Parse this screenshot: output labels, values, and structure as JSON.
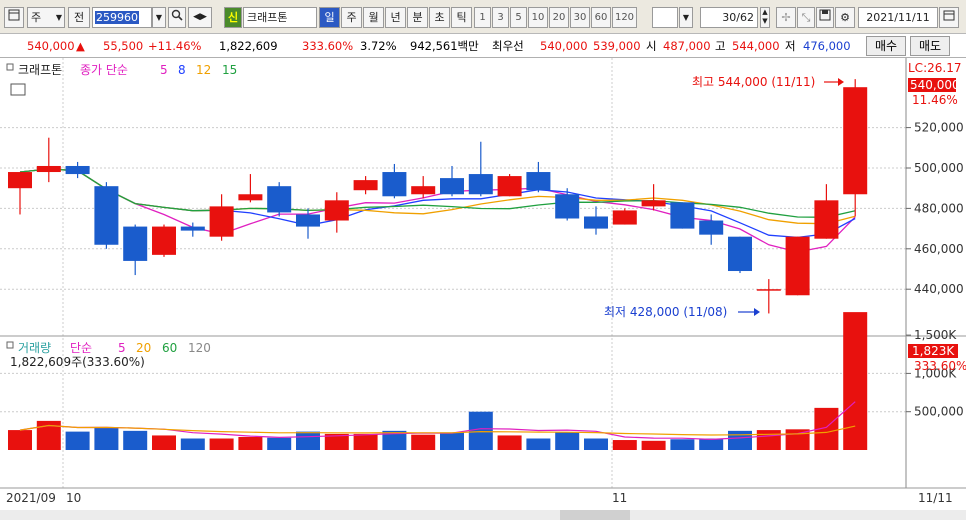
{
  "toolbar": {
    "mode": "주",
    "prev": "전",
    "code": "259960",
    "name": "크래프톤",
    "market_badge": "신",
    "period_tabs": [
      "일",
      "주",
      "월",
      "년",
      "분",
      "초",
      "틱"
    ],
    "period_active": "일",
    "intervals": [
      "1",
      "3",
      "5",
      "10",
      "20",
      "30",
      "60",
      "120"
    ],
    "page_count": "30/62",
    "date": "2021/11/11"
  },
  "quote": {
    "price": "540,000",
    "arrow": "▲",
    "change": "55,500",
    "change_pct": "+11.46%",
    "volume": "1,822,609",
    "vol_ratio": "333.60%",
    "turnover": "3.72%",
    "amount": "942,561백만",
    "status": "최우선",
    "bid": "540,000",
    "ask": "539,000",
    "open_label": "시",
    "open": "487,000",
    "high_label": "고",
    "high": "544,000",
    "low_label": "저",
    "low": "476,000",
    "buy_label": "매수",
    "sell_label": "매도"
  },
  "price_panel": {
    "legend_name": "크래프톤",
    "legend_ma": "종가 단순",
    "ma_periods": [
      "5",
      "8",
      "12",
      "15"
    ],
    "ma_colors": [
      "#e020c0",
      "#2040ff",
      "#f0a000",
      "#20a040"
    ],
    "y_ticks": [
      "520,000",
      "500,000",
      "480,000",
      "460,000",
      "440,000"
    ],
    "lc_label": "LC:26.17",
    "last_label": "540,000",
    "last_pct": "11.46%",
    "high_note": "최고 544,000 (11/11)",
    "low_note": "최저 428,000 (11/08)"
  },
  "volume_panel": {
    "legend_name": "거래량",
    "legend_ma": "단순",
    "ma_periods": [
      "5",
      "20",
      "60",
      "120"
    ],
    "ma_colors": [
      "#e020c0",
      "#f0a000",
      "#20a040",
      "#888888"
    ],
    "value_text": "1,822,609주(333.60%)",
    "y_ticks": [
      "1,500K",
      "1,000K",
      "500,000"
    ],
    "last_label": "1,823K",
    "last_pct": "333.60%"
  },
  "x_axis": {
    "labels": [
      "2021/09",
      "10",
      "11",
      "11/11"
    ]
  },
  "colors": {
    "up": "#e8110e",
    "down": "#1a5ccc"
  },
  "chart_data": {
    "type": "candlestick",
    "candles": [
      {
        "o": 490000,
        "h": 497000,
        "l": 477000,
        "c": 498000
      },
      {
        "o": 498000,
        "h": 515000,
        "l": 493000,
        "c": 501000
      },
      {
        "o": 501000,
        "h": 503000,
        "l": 495000,
        "c": 497000
      },
      {
        "o": 491000,
        "h": 493000,
        "l": 460000,
        "c": 462000
      },
      {
        "o": 471000,
        "h": 472000,
        "l": 447000,
        "c": 454000
      },
      {
        "o": 457000,
        "h": 472000,
        "l": 456000,
        "c": 471000
      },
      {
        "o": 471000,
        "h": 473000,
        "l": 466000,
        "c": 469000
      },
      {
        "o": 466000,
        "h": 487000,
        "l": 464000,
        "c": 481000
      },
      {
        "o": 484000,
        "h": 497000,
        "l": 483000,
        "c": 487000
      },
      {
        "o": 491000,
        "h": 493000,
        "l": 476000,
        "c": 478000
      },
      {
        "o": 477000,
        "h": 480000,
        "l": 465000,
        "c": 471000
      },
      {
        "o": 474000,
        "h": 488000,
        "l": 468000,
        "c": 484000
      },
      {
        "o": 489000,
        "h": 496000,
        "l": 487000,
        "c": 494000
      },
      {
        "o": 498000,
        "h": 502000,
        "l": 485000,
        "c": 486000
      },
      {
        "o": 487000,
        "h": 496000,
        "l": 485000,
        "c": 491000
      },
      {
        "o": 495000,
        "h": 501000,
        "l": 486000,
        "c": 487000
      },
      {
        "o": 497000,
        "h": 513000,
        "l": 486000,
        "c": 487000
      },
      {
        "o": 486000,
        "h": 497000,
        "l": 486000,
        "c": 496000
      },
      {
        "o": 498000,
        "h": 503000,
        "l": 488000,
        "c": 489000
      },
      {
        "o": 487000,
        "h": 490000,
        "l": 474000,
        "c": 475000
      },
      {
        "o": 476000,
        "h": 481000,
        "l": 467000,
        "c": 470000
      },
      {
        "o": 472000,
        "h": 480000,
        "l": 472000,
        "c": 479000
      },
      {
        "o": 481000,
        "h": 492000,
        "l": 479000,
        "c": 484000
      },
      {
        "o": 483000,
        "h": 483000,
        "l": 470000,
        "c": 470000
      },
      {
        "o": 474000,
        "h": 477000,
        "l": 462000,
        "c": 467000
      },
      {
        "o": 466000,
        "h": 466000,
        "l": 448000,
        "c": 449000
      },
      {
        "o": 440000,
        "h": 445000,
        "l": 428000,
        "c": 440000
      },
      {
        "o": 437000,
        "h": 466000,
        "l": 437000,
        "c": 466000
      },
      {
        "o": 465000,
        "h": 492000,
        "l": 465000,
        "c": 484000
      },
      {
        "o": 487000,
        "h": 544000,
        "l": 476000,
        "c": 540000
      }
    ],
    "volumes": [
      260,
      380,
      240,
      300,
      250,
      190,
      150,
      150,
      170,
      160,
      240,
      210,
      210,
      250,
      200,
      230,
      500,
      190,
      150,
      230,
      150,
      130,
      120,
      140,
      150,
      250,
      260,
      270,
      550,
      1823
    ],
    "volume_unit": "K"
  }
}
